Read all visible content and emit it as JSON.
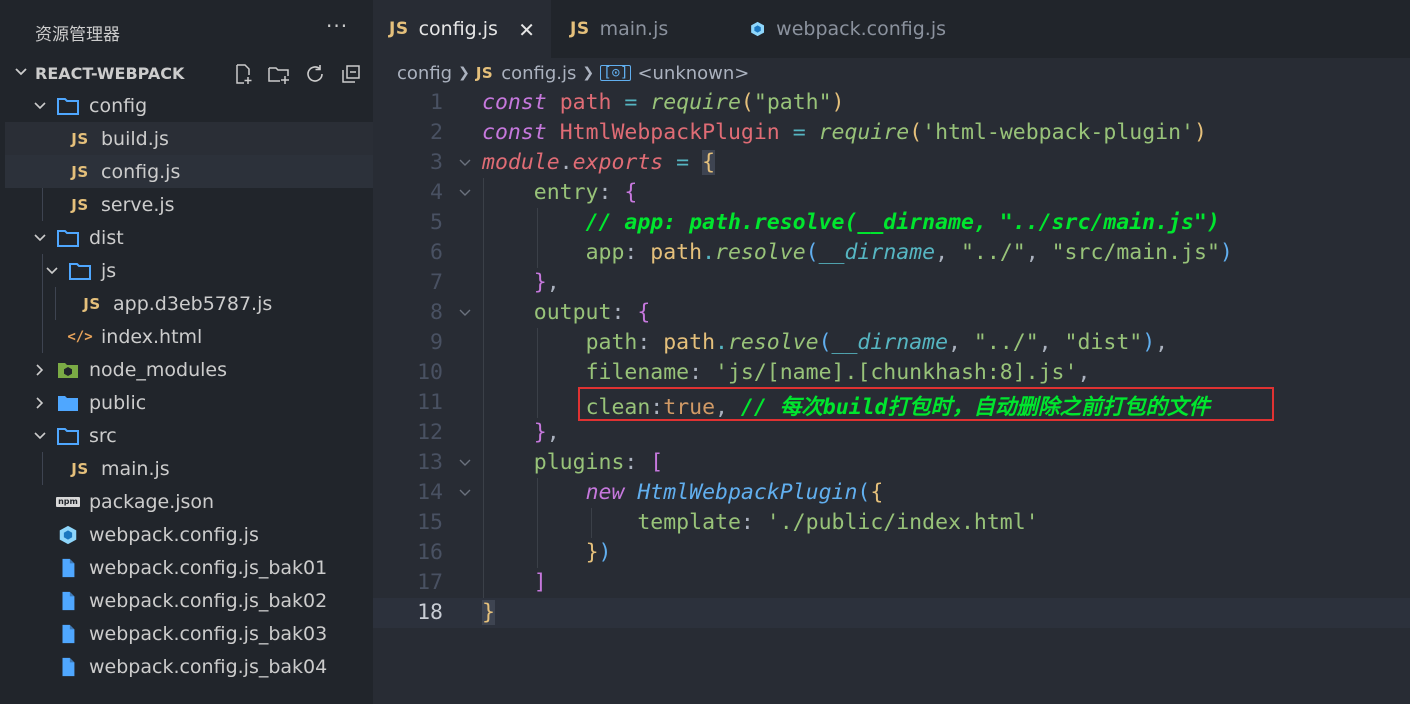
{
  "sidebar": {
    "title": "资源管理器",
    "more": "···",
    "project": "REACT-WEBPACK",
    "tree": [
      {
        "label": "config",
        "type": "folder-open"
      },
      {
        "label": "build.js",
        "type": "js"
      },
      {
        "label": "config.js",
        "type": "js",
        "selected": true
      },
      {
        "label": "serve.js",
        "type": "js"
      },
      {
        "label": "dist",
        "type": "folder-open"
      },
      {
        "label": "js",
        "type": "folder-open"
      },
      {
        "label": "app.d3eb5787.js",
        "type": "js"
      },
      {
        "label": "index.html",
        "type": "html"
      },
      {
        "label": "node_modules",
        "type": "folder-closed"
      },
      {
        "label": "public",
        "type": "folder-closed"
      },
      {
        "label": "src",
        "type": "folder-open"
      },
      {
        "label": "main.js",
        "type": "js"
      },
      {
        "label": "package.json",
        "type": "npm"
      },
      {
        "label": "webpack.config.js",
        "type": "webpack"
      },
      {
        "label": "webpack.config.js_bak01",
        "type": "file"
      },
      {
        "label": "webpack.config.js_bak02",
        "type": "file"
      },
      {
        "label": "webpack.config.js_bak03",
        "type": "file"
      },
      {
        "label": "webpack.config.js_bak04",
        "type": "file"
      }
    ]
  },
  "tabs": [
    {
      "label": "config.js",
      "icon": "JS",
      "active": true,
      "close": "✕"
    },
    {
      "label": "main.js",
      "icon": "JS"
    },
    {
      "label": "webpack.config.js",
      "icon": "webpack-icon"
    }
  ],
  "breadcrumb": {
    "folder": "config",
    "file": "config.js",
    "symbol": "<unknown>"
  },
  "editor": {
    "current_line": "18",
    "line_numbers": [
      "1",
      "2",
      "3",
      "4",
      "5",
      "6",
      "7",
      "8",
      "9",
      "10",
      "11",
      "12",
      "13",
      "14",
      "15",
      "16",
      "17",
      "18"
    ],
    "tokens": {
      "const": "const",
      "path": "path",
      "eq": " = ",
      "require": "require",
      "str_path": "\"path\"",
      "HtmlWebpackPlugin": "HtmlWebpackPlugin",
      "str_hwp": "'html-webpack-plugin'",
      "module": "module",
      "exports": "exports",
      "entry": "entry",
      "comment_app": "// app: path.resolve(__dirname, \"../src/main.js\")",
      "app": "app",
      "resolve": "resolve",
      "dirname": "__dirname",
      "str_up": "\"../\"",
      "str_main": "\"src/main.js\"",
      "output": "output",
      "str_dist": "\"dist\"",
      "filename": "filename",
      "str_filename": "'js/[name].[chunkhash:8].js'",
      "clean": "clean",
      "true": "true",
      "comment_clean": "// 每次build打包时，自动删除之前打包的文件",
      "plugins": "plugins",
      "new": "new",
      "template": "template",
      "str_template": "'./public/index.html'"
    }
  },
  "colors": {
    "highlight_box": "#e03232",
    "comment": "#00e62e"
  }
}
